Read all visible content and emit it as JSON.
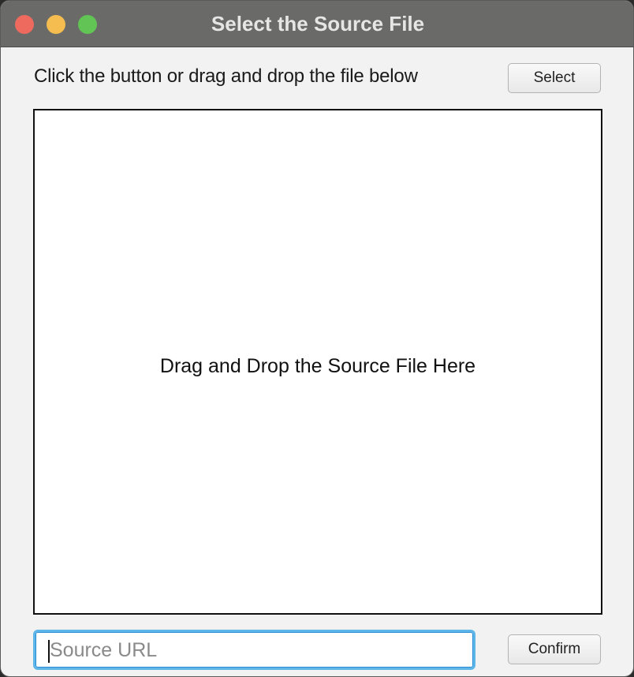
{
  "window": {
    "title": "Select the Source File"
  },
  "header": {
    "instruction": "Click the button or drag and drop the file below",
    "select_label": "Select"
  },
  "dropzone": {
    "label": "Drag and Drop the Source File Here"
  },
  "footer": {
    "url_value": "",
    "url_placeholder": "Source URL",
    "confirm_label": "Confirm"
  },
  "colors": {
    "titlebar": "#6a6a68",
    "close": "#ee6a5e",
    "minimize": "#f5bd4f",
    "maximize": "#61c454",
    "focus_ring": "#5eb5e8"
  }
}
